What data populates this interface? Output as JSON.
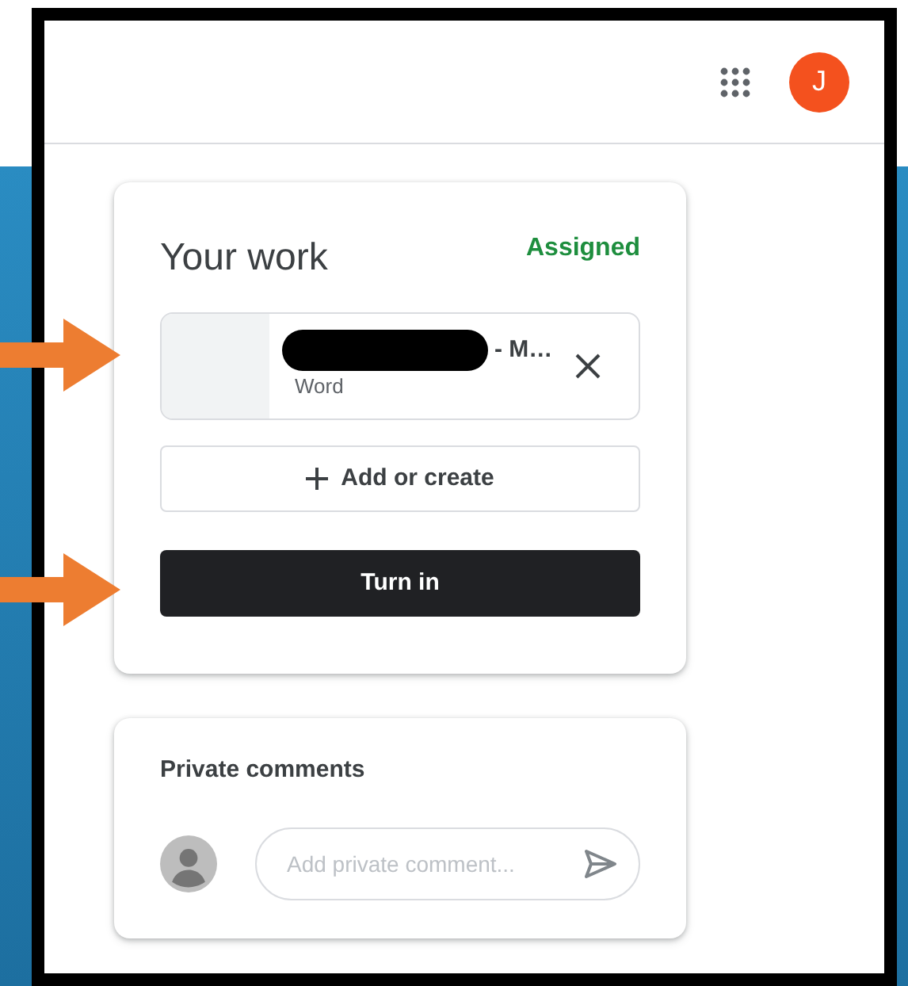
{
  "header": {
    "avatar_letter": "J"
  },
  "your_work": {
    "title": "Your work",
    "status": "Assigned",
    "attachments": [
      {
        "name": "- M…",
        "type": "Word",
        "redacted": true
      }
    ],
    "add_button": "Add or create",
    "turn_in_button": "Turn in"
  },
  "private_comments": {
    "title": "Private comments",
    "placeholder": "Add private comment..."
  },
  "annotations": [
    {
      "kind": "arrow"
    },
    {
      "kind": "arrow"
    }
  ]
}
